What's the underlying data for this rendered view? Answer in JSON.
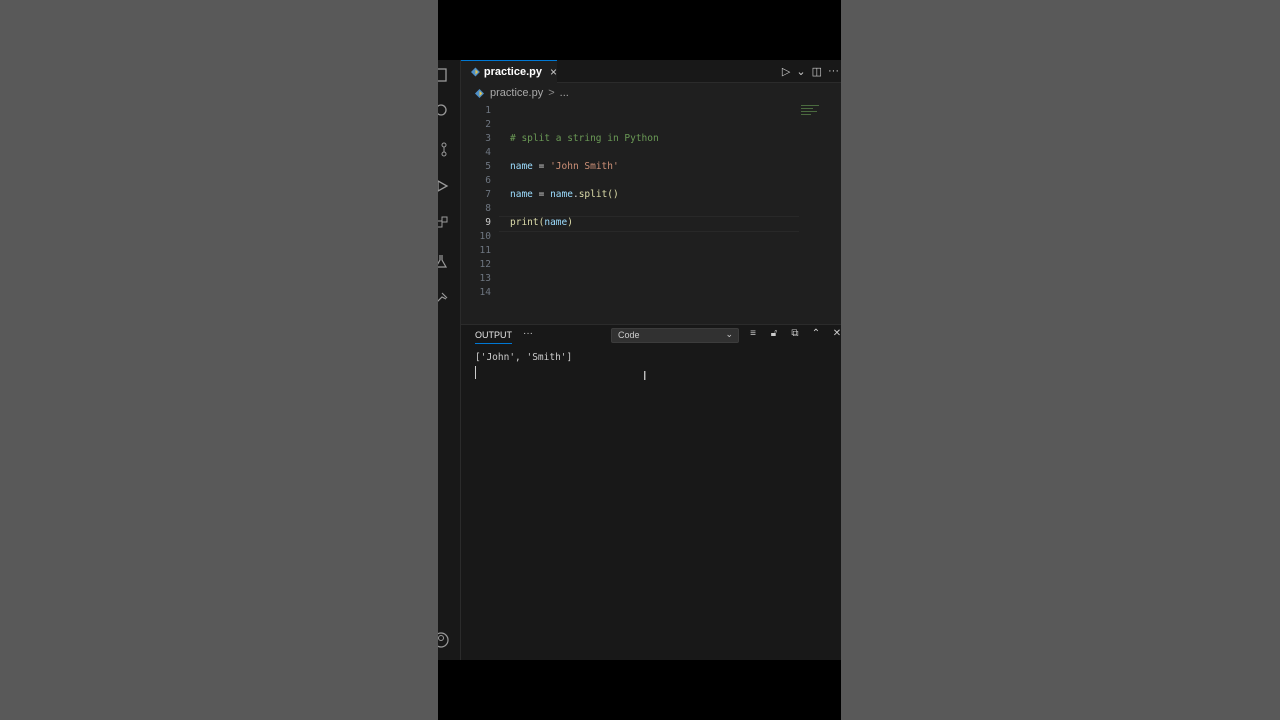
{
  "tab": {
    "filename": "practice.py",
    "close": "×"
  },
  "tab_actions": {
    "run": "▷",
    "run_menu": "⌄",
    "split": "◫",
    "more": "···"
  },
  "breadcrumb": {
    "file": "practice.py",
    "separator": ">",
    "ellipsis": "..."
  },
  "editor": {
    "active_line": 9,
    "lines": [
      {
        "n": "1",
        "text": ""
      },
      {
        "n": "2",
        "text": ""
      },
      {
        "n": "3",
        "comment": "# split a string in Python"
      },
      {
        "n": "4",
        "text": ""
      },
      {
        "n": "5",
        "var": "name",
        "op": " = ",
        "str": "'John Smith'"
      },
      {
        "n": "6",
        "text": ""
      },
      {
        "n": "7",
        "var": "name",
        "op": " = ",
        "var2": "name",
        "dot": ".",
        "fn": "split",
        "punc": "()"
      },
      {
        "n": "8",
        "text": ""
      },
      {
        "n": "9",
        "fn": "print",
        "paren_open": "(",
        "arg": "name",
        "paren_close": ")"
      },
      {
        "n": "10",
        "text": ""
      },
      {
        "n": "11",
        "text": ""
      },
      {
        "n": "12",
        "text": ""
      },
      {
        "n": "13",
        "text": ""
      },
      {
        "n": "14",
        "text": ""
      }
    ]
  },
  "panel": {
    "tab_label": "OUTPUT",
    "more": "···",
    "channel_select": "Code",
    "output_text": "['John', 'Smith']",
    "icons": [
      "clear-output-icon",
      "lock-scroll-icon",
      "open-in-editor-icon",
      "maximize-panel-icon",
      "close-panel-icon"
    ]
  },
  "colors": {
    "editor_bg": "#1f1f1f",
    "panel_bg": "#181818",
    "accent": "#0078d4",
    "comment": "#6a9955",
    "string": "#ce9178",
    "variable": "#9cdcfe",
    "function": "#dcdcaa"
  }
}
